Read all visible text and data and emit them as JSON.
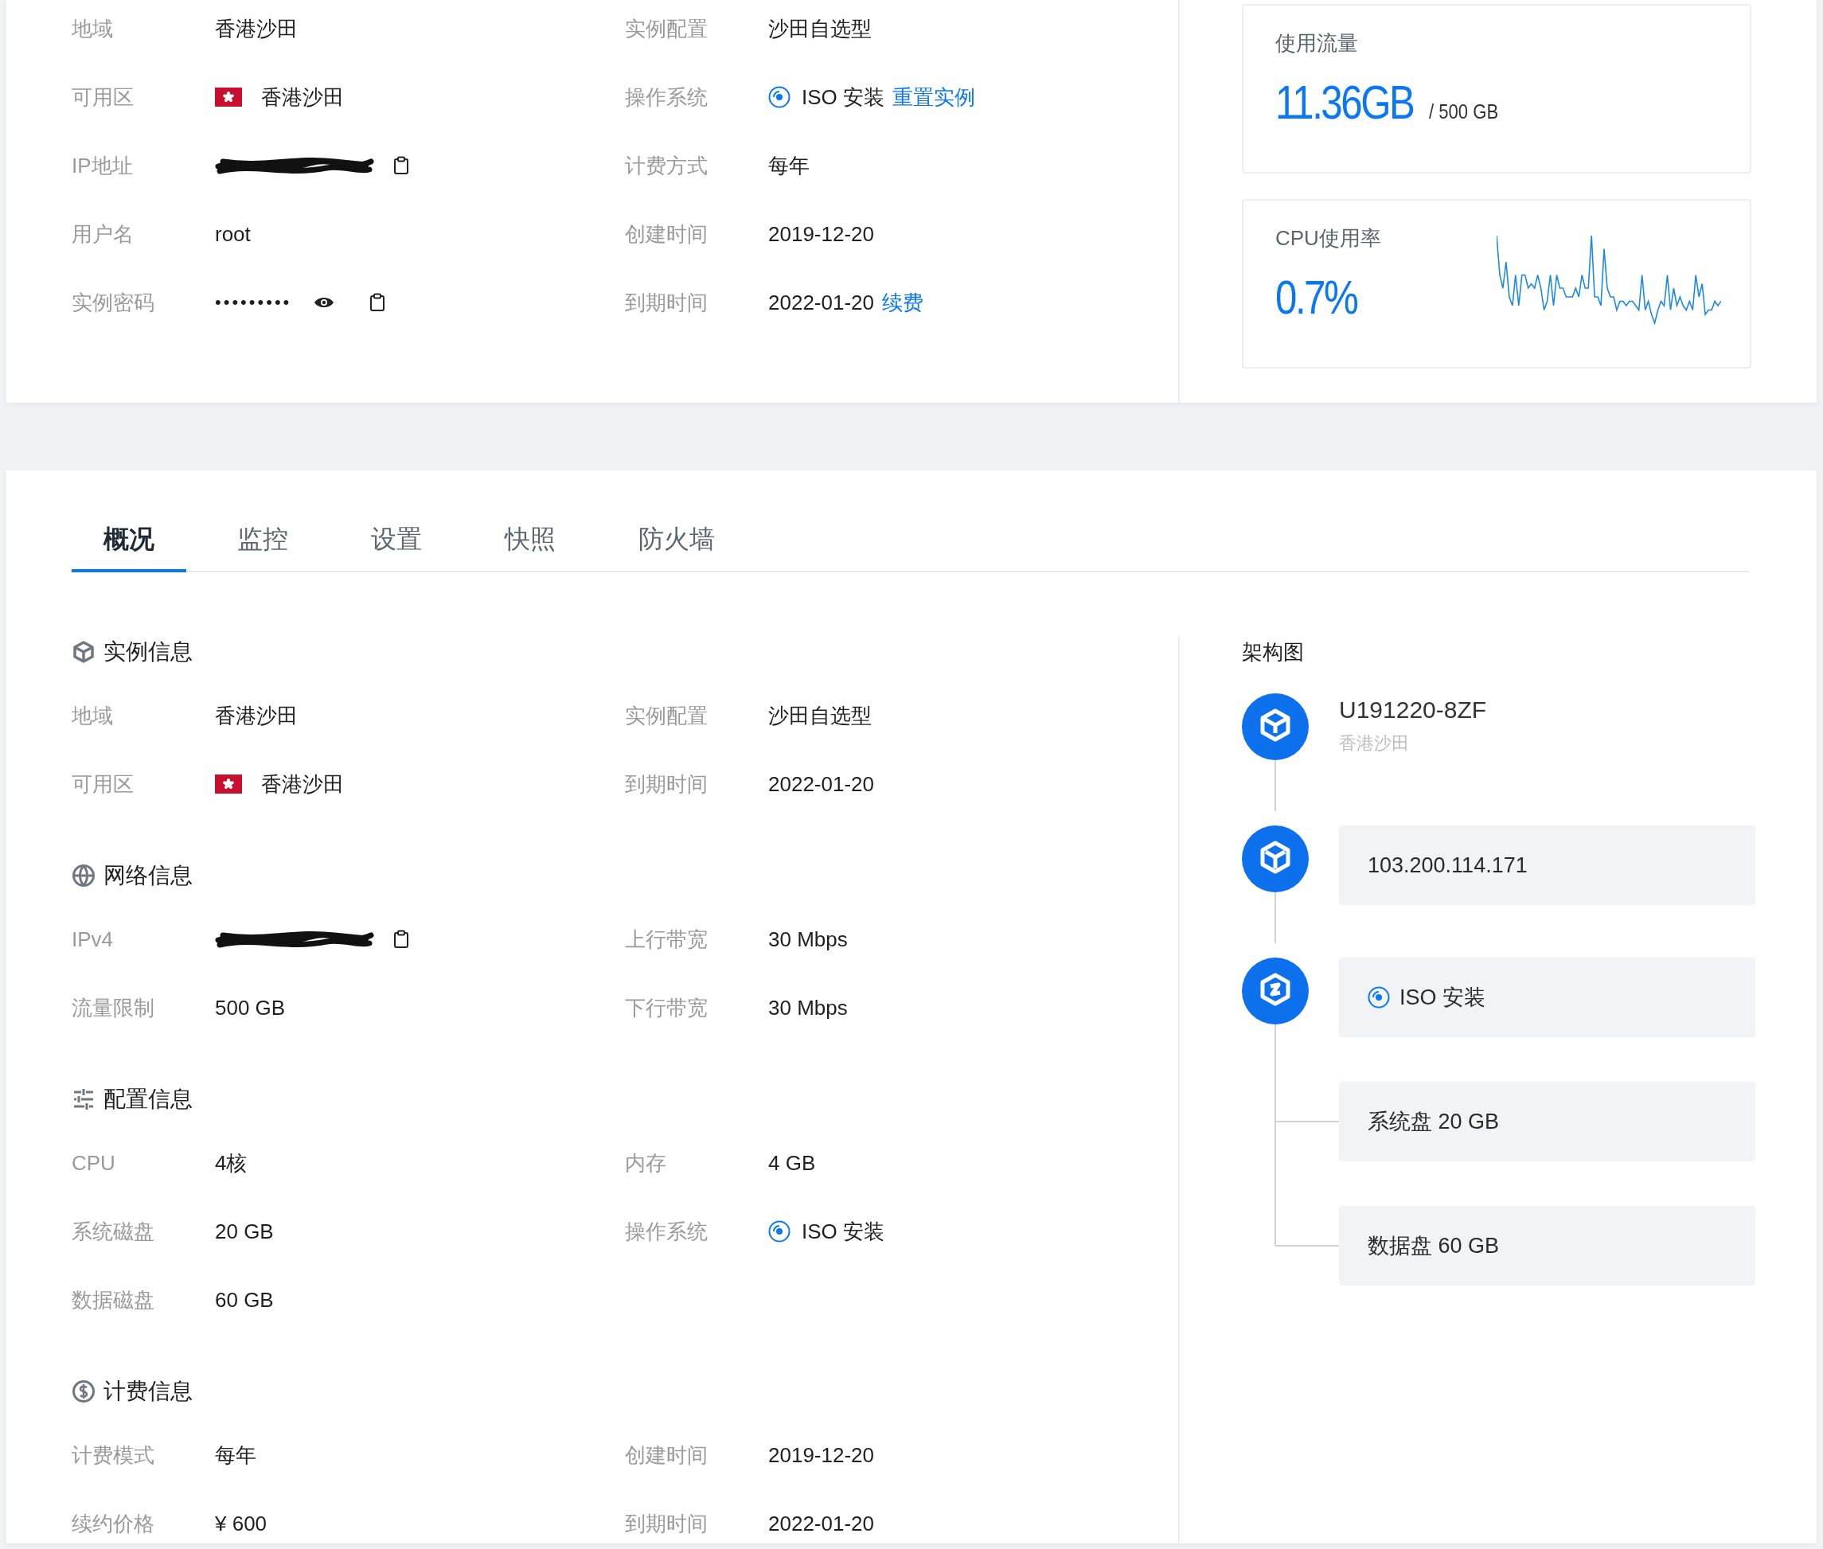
{
  "overview": {
    "fields": [
      {
        "label": "地域",
        "kind": "text",
        "value": "香港沙田"
      },
      {
        "label": "实例配置",
        "kind": "text",
        "value": "沙田自选型"
      },
      {
        "label": "可用区",
        "kind": "flag",
        "value": "香港沙田"
      },
      {
        "label": "操作系统",
        "kind": "os",
        "value": "ISO 安装",
        "link": "重置实例"
      },
      {
        "label": "IP地址",
        "kind": "redacted"
      },
      {
        "label": "计费方式",
        "kind": "text",
        "value": "每年"
      },
      {
        "label": "用户名",
        "kind": "text",
        "value": "root"
      },
      {
        "label": "创建时间",
        "kind": "text",
        "value": "2019-12-20"
      },
      {
        "label": "实例密码",
        "kind": "secret",
        "value": "•••••••••"
      },
      {
        "label": "到期时间",
        "kind": "text",
        "value": "2022-01-20",
        "link": "续费"
      }
    ]
  },
  "traffic": {
    "title": "使用流量",
    "used": "11.36GB",
    "total": "/ 500 GB"
  },
  "cpu": {
    "title": "CPU使用率",
    "value": "0.7%"
  },
  "tabs": [
    {
      "label": "概况",
      "selected": true
    },
    {
      "label": "监控",
      "selected": false
    },
    {
      "label": "设置",
      "selected": false
    },
    {
      "label": "快照",
      "selected": false
    },
    {
      "label": "防火墙",
      "selected": false
    }
  ],
  "sections": [
    {
      "kind": "instance",
      "title": "实例信息",
      "fields": [
        {
          "label": "地域",
          "kind": "text",
          "value": "香港沙田"
        },
        {
          "label": "实例配置",
          "kind": "text",
          "value": "沙田自选型"
        },
        {
          "label": "可用区",
          "kind": "flag",
          "value": "香港沙田"
        },
        {
          "label": "到期时间",
          "kind": "text",
          "value": "2022-01-20"
        }
      ]
    },
    {
      "kind": "network",
      "title": "网络信息",
      "fields": [
        {
          "label": "IPv4",
          "kind": "redacted"
        },
        {
          "label": "上行带宽",
          "kind": "text",
          "value": "30 Mbps"
        },
        {
          "label": "流量限制",
          "kind": "text",
          "value": "500 GB"
        },
        {
          "label": "下行带宽",
          "kind": "text",
          "value": "30 Mbps"
        }
      ]
    },
    {
      "kind": "config",
      "title": "配置信息",
      "fields": [
        {
          "label": "CPU",
          "kind": "text",
          "value": "4核"
        },
        {
          "label": "内存",
          "kind": "text",
          "value": "4 GB"
        },
        {
          "label": "系统磁盘",
          "kind": "text",
          "value": "20 GB"
        },
        {
          "label": "操作系统",
          "kind": "os",
          "value": "ISO 安装"
        },
        {
          "label": "数据磁盘",
          "kind": "text",
          "value": "60 GB"
        }
      ]
    },
    {
      "kind": "billing",
      "title": "计费信息",
      "fields": [
        {
          "label": "计费模式",
          "kind": "text",
          "value": "每年"
        },
        {
          "label": "创建时间",
          "kind": "text",
          "value": "2019-12-20"
        },
        {
          "label": "续约价格",
          "kind": "text",
          "value": "¥ 600"
        },
        {
          "label": "到期时间",
          "kind": "text",
          "value": "2022-01-20"
        }
      ]
    }
  ],
  "architecture": {
    "title": "架构图",
    "nodes": [
      {
        "kind": "instance",
        "name": "U191220-8ZF",
        "sub": "香港沙田"
      },
      {
        "kind": "network",
        "items": [
          {
            "kind": "text",
            "text": "103.200.114.171"
          }
        ]
      },
      {
        "kind": "storage",
        "items": [
          {
            "kind": "os",
            "text": "ISO 安装"
          },
          {
            "kind": "text",
            "text": "系统盘 20 GB"
          },
          {
            "kind": "text",
            "text": "数据盘 60 GB"
          }
        ]
      }
    ]
  }
}
